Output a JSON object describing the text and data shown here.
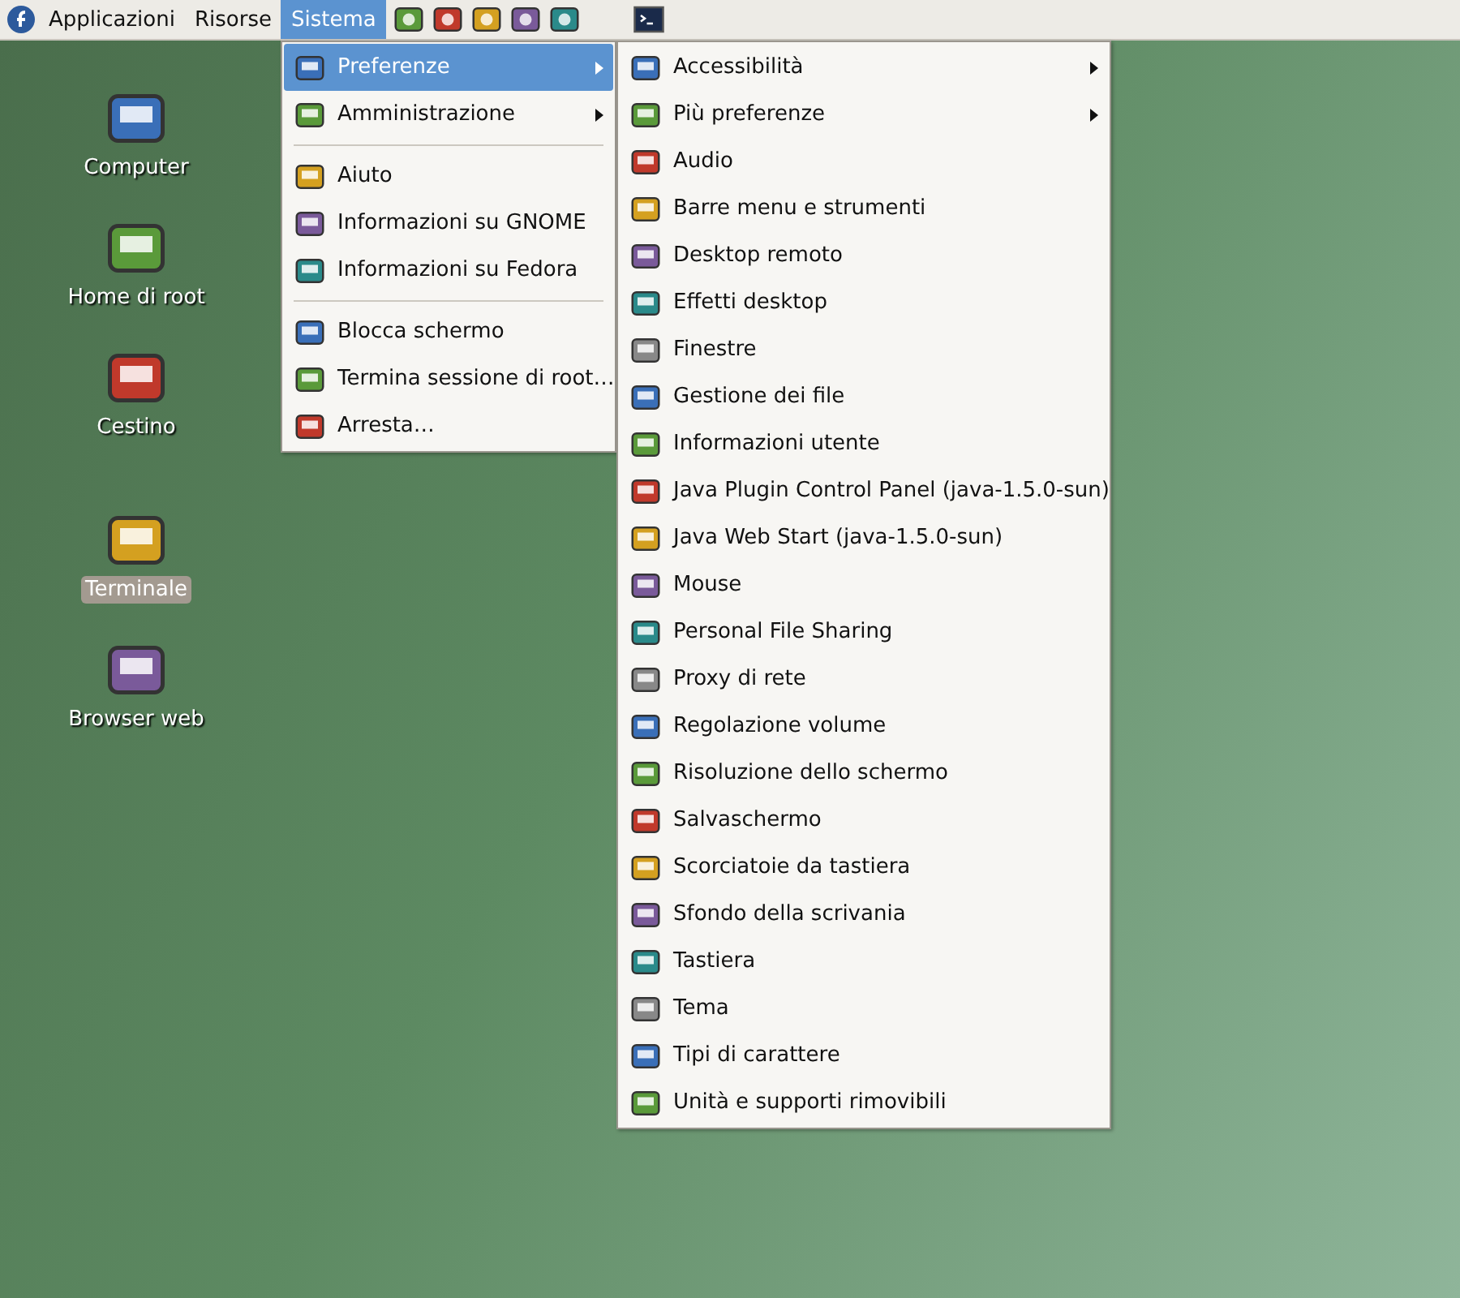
{
  "top_panel": {
    "menus": [
      {
        "label": "Applicazioni",
        "selected": false
      },
      {
        "label": "Risorse",
        "selected": false
      },
      {
        "label": "Sistema",
        "selected": true
      }
    ]
  },
  "system_menu": {
    "items": [
      {
        "kind": "item",
        "label": "Preferenze",
        "has_submenu": true,
        "selected": true
      },
      {
        "kind": "item",
        "label": "Amministrazione",
        "has_submenu": true,
        "selected": false
      },
      {
        "kind": "separator"
      },
      {
        "kind": "item",
        "label": "Aiuto",
        "has_submenu": false,
        "selected": false
      },
      {
        "kind": "item",
        "label": "Informazioni su GNOME",
        "has_submenu": false,
        "selected": false
      },
      {
        "kind": "item",
        "label": "Informazioni su Fedora",
        "has_submenu": false,
        "selected": false
      },
      {
        "kind": "separator"
      },
      {
        "kind": "item",
        "label": "Blocca schermo",
        "has_submenu": false,
        "selected": false
      },
      {
        "kind": "item",
        "label": "Termina sessione di root…",
        "has_submenu": false,
        "selected": false
      },
      {
        "kind": "item",
        "label": "Arresta…",
        "has_submenu": false,
        "selected": false
      }
    ]
  },
  "preferences_submenu": {
    "items": [
      {
        "kind": "item",
        "label": "Accessibilità",
        "has_submenu": true,
        "selected": false
      },
      {
        "kind": "item",
        "label": "Più preferenze",
        "has_submenu": true,
        "selected": false
      },
      {
        "kind": "item",
        "label": "Audio",
        "has_submenu": false,
        "selected": false
      },
      {
        "kind": "item",
        "label": "Barre menu e strumenti",
        "has_submenu": false,
        "selected": false
      },
      {
        "kind": "item",
        "label": "Desktop remoto",
        "has_submenu": false,
        "selected": false
      },
      {
        "kind": "item",
        "label": "Effetti desktop",
        "has_submenu": false,
        "selected": false
      },
      {
        "kind": "item",
        "label": "Finestre",
        "has_submenu": false,
        "selected": false
      },
      {
        "kind": "item",
        "label": "Gestione dei file",
        "has_submenu": false,
        "selected": false
      },
      {
        "kind": "item",
        "label": "Informazioni utente",
        "has_submenu": false,
        "selected": false
      },
      {
        "kind": "item",
        "label": "Java Plugin Control Panel (java-1.5.0-sun)",
        "has_submenu": false,
        "selected": false
      },
      {
        "kind": "item",
        "label": "Java Web Start (java-1.5.0-sun)",
        "has_submenu": false,
        "selected": false
      },
      {
        "kind": "item",
        "label": "Mouse",
        "has_submenu": false,
        "selected": false
      },
      {
        "kind": "item",
        "label": "Personal File Sharing",
        "has_submenu": false,
        "selected": false
      },
      {
        "kind": "item",
        "label": "Proxy di rete",
        "has_submenu": false,
        "selected": false
      },
      {
        "kind": "item",
        "label": "Regolazione volume",
        "has_submenu": false,
        "selected": false
      },
      {
        "kind": "item",
        "label": "Risoluzione dello schermo",
        "has_submenu": false,
        "selected": false
      },
      {
        "kind": "item",
        "label": "Salvaschermo",
        "has_submenu": false,
        "selected": false
      },
      {
        "kind": "item",
        "label": "Scorciatoie da tastiera",
        "has_submenu": false,
        "selected": false
      },
      {
        "kind": "item",
        "label": "Sfondo della scrivania",
        "has_submenu": false,
        "selected": false
      },
      {
        "kind": "item",
        "label": "Tastiera",
        "has_submenu": false,
        "selected": false
      },
      {
        "kind": "item",
        "label": "Tema",
        "has_submenu": false,
        "selected": false
      },
      {
        "kind": "item",
        "label": "Tipi di carattere",
        "has_submenu": false,
        "selected": false
      },
      {
        "kind": "item",
        "label": "Unità e supporti rimovibili",
        "has_submenu": false,
        "selected": false
      }
    ]
  },
  "desktop_icons": [
    {
      "label": "Computer",
      "selected": false
    },
    {
      "label": "Home di root",
      "selected": false
    },
    {
      "label": "Cestino",
      "selected": false
    },
    {
      "label": "Terminale",
      "selected": true
    },
    {
      "label": "Browser web",
      "selected": false
    }
  ]
}
